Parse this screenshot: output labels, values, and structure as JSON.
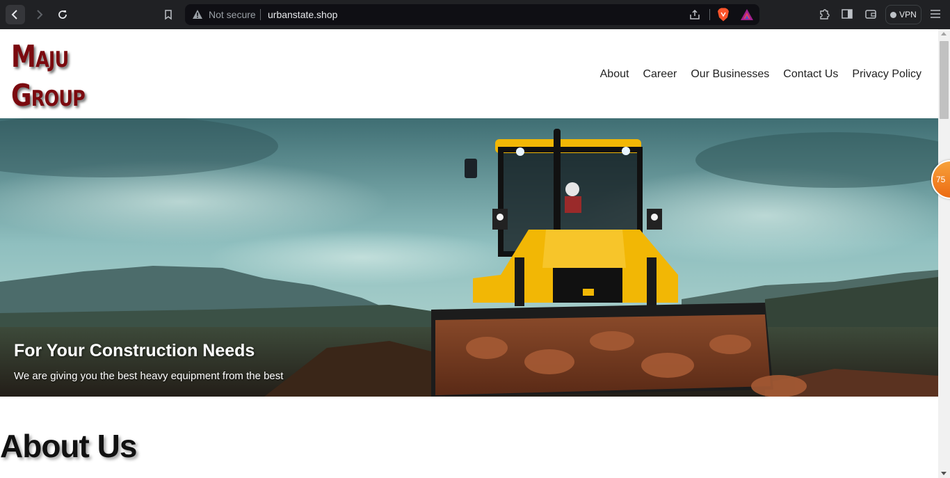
{
  "browser": {
    "security_label": "Not secure",
    "url": "urbanstate.shop",
    "vpn_label": "VPN"
  },
  "site": {
    "logo_line1": "Maju",
    "logo_line2": "Group",
    "nav": [
      "About",
      "Career",
      "Our Businesses",
      "Contact Us",
      "Privacy Policy"
    ]
  },
  "hero": {
    "title": "For Your Construction Needs",
    "subtitle": "We are giving you the best heavy equipment from the best"
  },
  "about": {
    "heading": "About Us"
  },
  "badge": {
    "value": "75"
  },
  "colors": {
    "logo": "#7b0a0f",
    "chrome": "#202124",
    "badge": "#f08a26",
    "machine": "#f2b705"
  }
}
